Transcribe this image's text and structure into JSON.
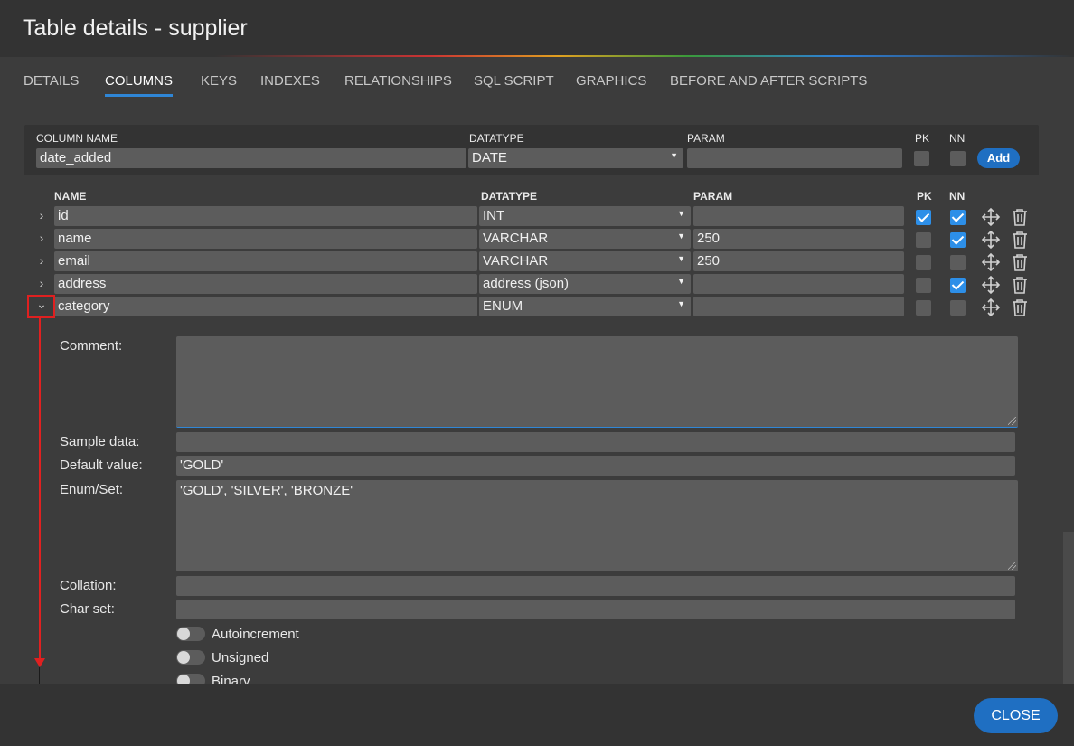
{
  "window": {
    "title": "Table details - supplier"
  },
  "tabs": [
    {
      "label": "DETAILS",
      "active": false
    },
    {
      "label": "COLUMNS",
      "active": true
    },
    {
      "label": "KEYS",
      "active": false
    },
    {
      "label": "INDEXES",
      "active": false
    },
    {
      "label": "RELATIONSHIPS",
      "active": false
    },
    {
      "label": "SQL SCRIPT",
      "active": false
    },
    {
      "label": "GRAPHICS",
      "active": false
    },
    {
      "label": "BEFORE AND AFTER SCRIPTS",
      "active": false
    }
  ],
  "new_column": {
    "name_label": "COLUMN NAME",
    "datatype_label": "DATATYPE",
    "param_label": "PARAM",
    "pk_label": "PK",
    "nn_label": "NN",
    "name_value": "date_added",
    "datatype_value": "DATE",
    "param_value": "",
    "pk": false,
    "nn": false,
    "add_label": "Add"
  },
  "columns_header": {
    "name": "NAME",
    "datatype": "DATATYPE",
    "param": "PARAM",
    "pk": "PK",
    "nn": "NN"
  },
  "columns": [
    {
      "name": "id",
      "datatype": "INT",
      "param": "",
      "pk": true,
      "nn": true,
      "expanded": false
    },
    {
      "name": "name",
      "datatype": "VARCHAR",
      "param": "250",
      "pk": false,
      "nn": true,
      "expanded": false
    },
    {
      "name": "email",
      "datatype": "VARCHAR",
      "param": "250",
      "pk": false,
      "nn": false,
      "expanded": false
    },
    {
      "name": "address",
      "datatype": "address (json)",
      "param": "",
      "pk": false,
      "nn": true,
      "expanded": false
    },
    {
      "name": "category",
      "datatype": "ENUM",
      "param": "",
      "pk": false,
      "nn": false,
      "expanded": true
    }
  ],
  "detail": {
    "comment_label": "Comment:",
    "comment_value": "",
    "sample_label": "Sample data:",
    "sample_value": "",
    "default_label": "Default value:",
    "default_value": "'GOLD'",
    "enum_label": "Enum/Set:",
    "enum_value": "'GOLD', 'SILVER', 'BRONZE'",
    "collation_label": "Collation:",
    "collation_value": "",
    "charset_label": "Char set:",
    "charset_value": "",
    "toggles": [
      {
        "label": "Autoincrement",
        "on": false
      },
      {
        "label": "Unsigned",
        "on": false
      },
      {
        "label": "Binary",
        "on": false
      }
    ]
  },
  "footer": {
    "close_label": "CLOSE"
  },
  "icons": {
    "expand": "chevron-right-icon",
    "collapse": "chevron-down-icon",
    "move": "move-icon",
    "delete": "trash-icon"
  },
  "colors": {
    "accent": "#2f86d6",
    "button": "#1f6fc2",
    "checked": "#2d8fe8",
    "annotation": "#e02020"
  }
}
